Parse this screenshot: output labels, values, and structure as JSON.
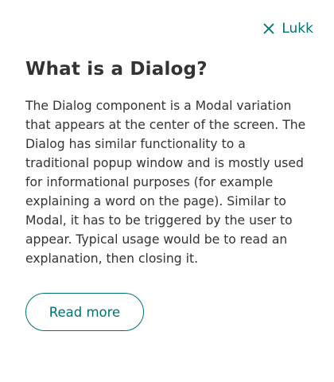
{
  "dialog": {
    "close_label": "Lukk",
    "title": "What is a Dialog?",
    "body": "The Dialog component is a Modal variation that appears at the center of the screen. The Dialog has similar functionality to a traditional popup window and is mostly used for informational purposes (for example explaining a word on the page). Similar to Modal, it has to be triggered by the user to appear. Typical usage would be to read an explanation, then closing it.",
    "read_more_label": "Read more"
  },
  "icons": {
    "close": "close-icon"
  },
  "colors": {
    "accent": "#007272",
    "text": "#333333",
    "background": "#ffffff"
  }
}
